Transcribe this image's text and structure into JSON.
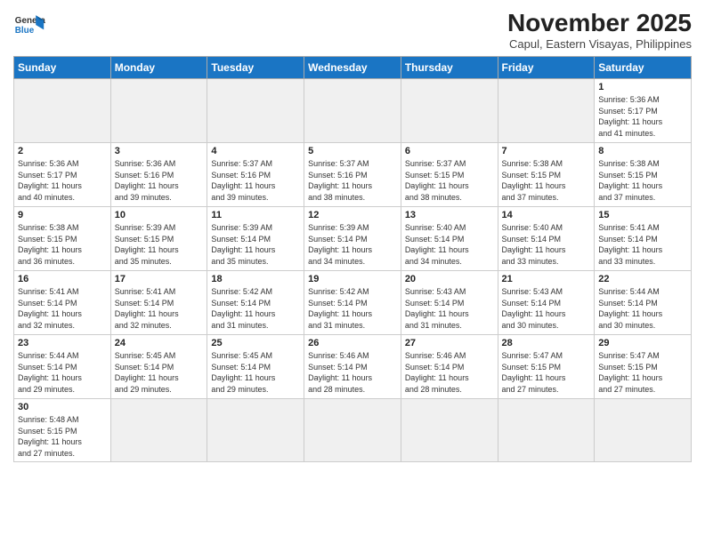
{
  "header": {
    "logo_line1": "General",
    "logo_line2": "Blue",
    "month": "November 2025",
    "location": "Capul, Eastern Visayas, Philippines"
  },
  "weekdays": [
    "Sunday",
    "Monday",
    "Tuesday",
    "Wednesday",
    "Thursday",
    "Friday",
    "Saturday"
  ],
  "days": [
    {
      "date": null,
      "info": null
    },
    {
      "date": null,
      "info": null
    },
    {
      "date": null,
      "info": null
    },
    {
      "date": null,
      "info": null
    },
    {
      "date": null,
      "info": null
    },
    {
      "date": null,
      "info": null
    },
    {
      "date": "1",
      "info": "Sunrise: 5:36 AM\nSunset: 5:17 PM\nDaylight: 11 hours\nand 41 minutes."
    },
    {
      "date": "2",
      "info": "Sunrise: 5:36 AM\nSunset: 5:17 PM\nDaylight: 11 hours\nand 40 minutes."
    },
    {
      "date": "3",
      "info": "Sunrise: 5:36 AM\nSunset: 5:16 PM\nDaylight: 11 hours\nand 39 minutes."
    },
    {
      "date": "4",
      "info": "Sunrise: 5:37 AM\nSunset: 5:16 PM\nDaylight: 11 hours\nand 39 minutes."
    },
    {
      "date": "5",
      "info": "Sunrise: 5:37 AM\nSunset: 5:16 PM\nDaylight: 11 hours\nand 38 minutes."
    },
    {
      "date": "6",
      "info": "Sunrise: 5:37 AM\nSunset: 5:15 PM\nDaylight: 11 hours\nand 38 minutes."
    },
    {
      "date": "7",
      "info": "Sunrise: 5:38 AM\nSunset: 5:15 PM\nDaylight: 11 hours\nand 37 minutes."
    },
    {
      "date": "8",
      "info": "Sunrise: 5:38 AM\nSunset: 5:15 PM\nDaylight: 11 hours\nand 37 minutes."
    },
    {
      "date": "9",
      "info": "Sunrise: 5:38 AM\nSunset: 5:15 PM\nDaylight: 11 hours\nand 36 minutes."
    },
    {
      "date": "10",
      "info": "Sunrise: 5:39 AM\nSunset: 5:15 PM\nDaylight: 11 hours\nand 35 minutes."
    },
    {
      "date": "11",
      "info": "Sunrise: 5:39 AM\nSunset: 5:14 PM\nDaylight: 11 hours\nand 35 minutes."
    },
    {
      "date": "12",
      "info": "Sunrise: 5:39 AM\nSunset: 5:14 PM\nDaylight: 11 hours\nand 34 minutes."
    },
    {
      "date": "13",
      "info": "Sunrise: 5:40 AM\nSunset: 5:14 PM\nDaylight: 11 hours\nand 34 minutes."
    },
    {
      "date": "14",
      "info": "Sunrise: 5:40 AM\nSunset: 5:14 PM\nDaylight: 11 hours\nand 33 minutes."
    },
    {
      "date": "15",
      "info": "Sunrise: 5:41 AM\nSunset: 5:14 PM\nDaylight: 11 hours\nand 33 minutes."
    },
    {
      "date": "16",
      "info": "Sunrise: 5:41 AM\nSunset: 5:14 PM\nDaylight: 11 hours\nand 32 minutes."
    },
    {
      "date": "17",
      "info": "Sunrise: 5:41 AM\nSunset: 5:14 PM\nDaylight: 11 hours\nand 32 minutes."
    },
    {
      "date": "18",
      "info": "Sunrise: 5:42 AM\nSunset: 5:14 PM\nDaylight: 11 hours\nand 31 minutes."
    },
    {
      "date": "19",
      "info": "Sunrise: 5:42 AM\nSunset: 5:14 PM\nDaylight: 11 hours\nand 31 minutes."
    },
    {
      "date": "20",
      "info": "Sunrise: 5:43 AM\nSunset: 5:14 PM\nDaylight: 11 hours\nand 31 minutes."
    },
    {
      "date": "21",
      "info": "Sunrise: 5:43 AM\nSunset: 5:14 PM\nDaylight: 11 hours\nand 30 minutes."
    },
    {
      "date": "22",
      "info": "Sunrise: 5:44 AM\nSunset: 5:14 PM\nDaylight: 11 hours\nand 30 minutes."
    },
    {
      "date": "23",
      "info": "Sunrise: 5:44 AM\nSunset: 5:14 PM\nDaylight: 11 hours\nand 29 minutes."
    },
    {
      "date": "24",
      "info": "Sunrise: 5:45 AM\nSunset: 5:14 PM\nDaylight: 11 hours\nand 29 minutes."
    },
    {
      "date": "25",
      "info": "Sunrise: 5:45 AM\nSunset: 5:14 PM\nDaylight: 11 hours\nand 29 minutes."
    },
    {
      "date": "26",
      "info": "Sunrise: 5:46 AM\nSunset: 5:14 PM\nDaylight: 11 hours\nand 28 minutes."
    },
    {
      "date": "27",
      "info": "Sunrise: 5:46 AM\nSunset: 5:14 PM\nDaylight: 11 hours\nand 28 minutes."
    },
    {
      "date": "28",
      "info": "Sunrise: 5:47 AM\nSunset: 5:15 PM\nDaylight: 11 hours\nand 27 minutes."
    },
    {
      "date": "29",
      "info": "Sunrise: 5:47 AM\nSunset: 5:15 PM\nDaylight: 11 hours\nand 27 minutes."
    },
    {
      "date": "30",
      "info": "Sunrise: 5:48 AM\nSunset: 5:15 PM\nDaylight: 11 hours\nand 27 minutes."
    }
  ]
}
